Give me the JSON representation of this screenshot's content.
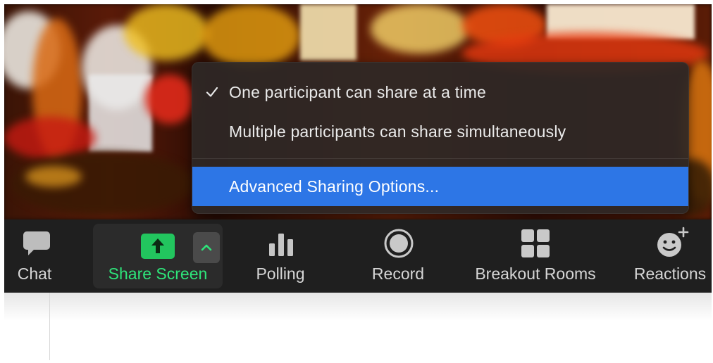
{
  "share_menu": {
    "items": [
      {
        "label": "One participant can share at a time",
        "checked": true
      },
      {
        "label": "Multiple participants can share simultaneously",
        "checked": false
      }
    ],
    "advanced_label": "Advanced Sharing Options..."
  },
  "toolbar": {
    "chat_label": "Chat",
    "share_label": "Share Screen",
    "polling_label": "Polling",
    "record_label": "Record",
    "breakout_label": "Breakout Rooms",
    "reactions_label": "Reactions"
  },
  "icons": {
    "chat": "chat-bubble-icon",
    "share": "share-screen-arrow-up-icon",
    "caret": "chevron-up-icon",
    "polling": "bar-chart-icon",
    "record": "record-circle-icon",
    "breakout": "grid-four-squares-icon",
    "reactions": "smiley-plus-icon",
    "checkmark": "checkmark-icon"
  },
  "colors": {
    "accent_green": "#22c55e",
    "share_text_green": "#2ee57a",
    "menu_highlight": "#2d76e6",
    "toolbar_bg": "#1f1f1f",
    "menu_bg": "#2e2826"
  }
}
